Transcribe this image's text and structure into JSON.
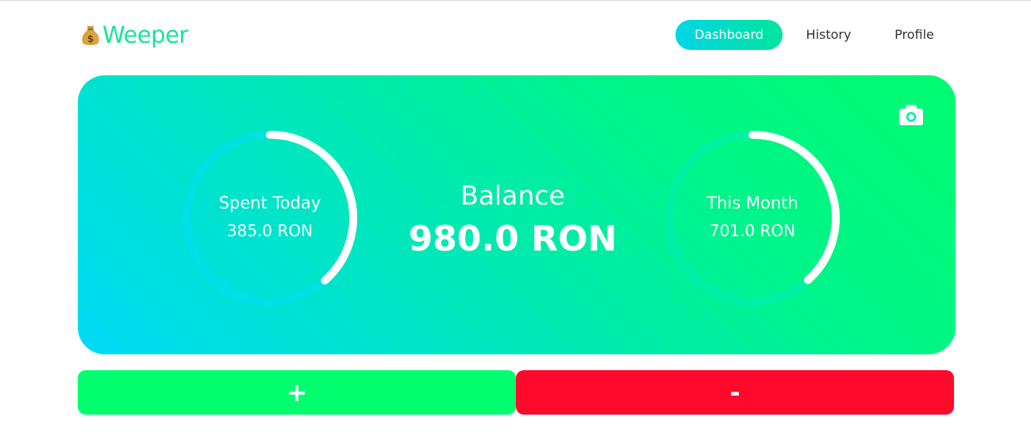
{
  "app": {
    "name": "Weeper",
    "logo_icon": "money-bag-icon",
    "brand_color": "#19e49a"
  },
  "nav": {
    "items": [
      {
        "label": "Dashboard",
        "active": true
      },
      {
        "label": "History",
        "active": false
      },
      {
        "label": "Profile",
        "active": false
      }
    ],
    "active_color": "#00dfc3"
  },
  "summary": {
    "camera_icon": "camera-icon",
    "spent_today": {
      "title": "Spent Today",
      "value": "385.0 RON",
      "progress": 0.385
    },
    "balance": {
      "title": "Balance",
      "value": "980.0 RON"
    },
    "this_month": {
      "title": "This Month",
      "value": "701.0 RON",
      "progress": 0.384
    }
  },
  "actions": {
    "add_label": "+",
    "subtract_label": "-",
    "add_color": "#00ff6e",
    "subtract_color": "#ff0a2a"
  }
}
